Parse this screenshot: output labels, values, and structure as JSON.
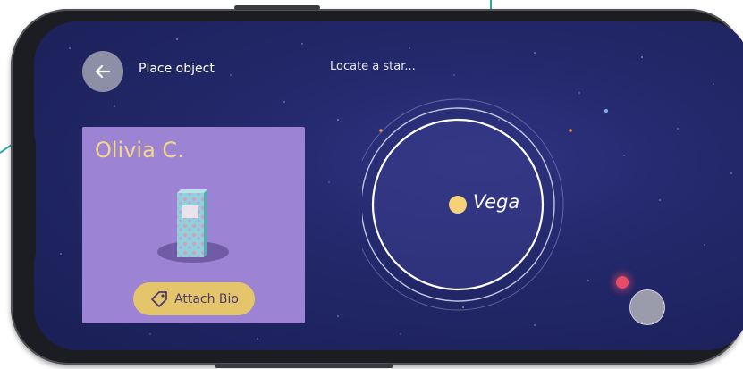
{
  "header": {
    "back_icon": "arrow-left-icon",
    "title": "Place object",
    "hint": "Locate a star..."
  },
  "card": {
    "name": "Olivia C.",
    "attach_label": "Attach Bio",
    "attach_icon": "tag-icon",
    "name_color": "#f2d98a",
    "background": "#9d83d4"
  },
  "star_map": {
    "star_name": "Vega",
    "star_color": "#f5d27a"
  },
  "colors": {
    "sky": "#23286b",
    "button_accent": "#e5c56b",
    "red_marker": "#e84a67"
  }
}
